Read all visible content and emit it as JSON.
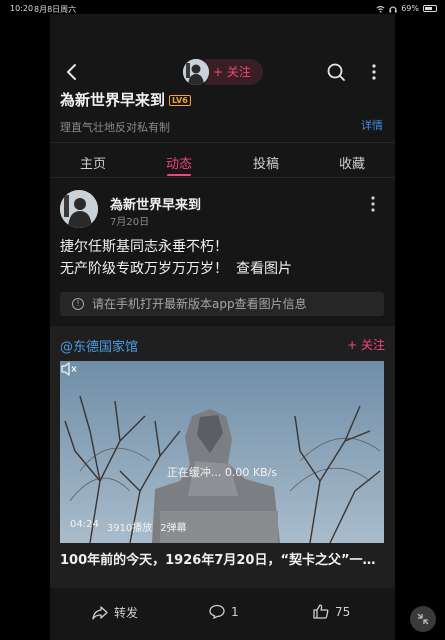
{
  "status_bar": {
    "time": "10:20",
    "date": "8月8日周六",
    "battery": "69%"
  },
  "header": {
    "follow_label": "+ 关注"
  },
  "profile": {
    "name": "為新世界早来到",
    "level_badge": "LV6",
    "signature": "理直气壮地反对私有制",
    "detail_label": "详情"
  },
  "tabs": [
    {
      "label": "主页"
    },
    {
      "label": "动态"
    },
    {
      "label": "投稿"
    },
    {
      "label": "收藏"
    }
  ],
  "active_tab": "动态",
  "post": {
    "author": "為新世界早来到",
    "date": "7月20日",
    "line1": "捷尔任斯基同志永垂不朽！",
    "line2": "无产阶级专政万岁万万岁！",
    "view_image": "查看图片",
    "notice": "请在手机打开最新版本app查看图片信息"
  },
  "forward": {
    "source": "@东德国家馆",
    "follow_label": "+ 关注",
    "video": {
      "buffering": "正在缓冲... 0.00 KB/s",
      "duration": "04:24",
      "plays": "3910播放",
      "danmaku": "2弹幕"
    },
    "title": "100年前的今天，1926年7月20日，“契卡之父”一…"
  },
  "actions": {
    "share": "转发",
    "comments": "1",
    "likes": "75"
  },
  "colors": {
    "accent": "#f0467a",
    "link": "#3a8ee6",
    "background": "#161616"
  }
}
